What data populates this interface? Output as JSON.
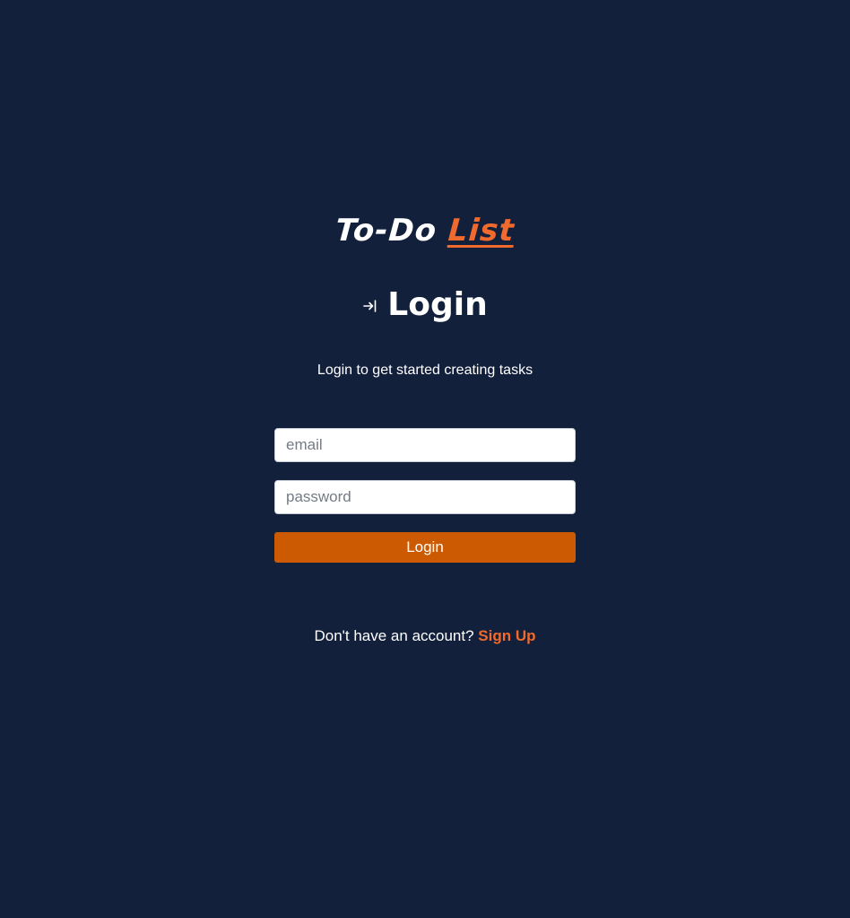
{
  "logo": {
    "first_word": "To-Do",
    "accent_word": "List",
    "accent_color": "#ef6a2c"
  },
  "heading": {
    "icon": "login-arrow-icon",
    "title": "Login"
  },
  "subtitle": "Login to get started creating tasks",
  "form": {
    "email": {
      "placeholder": "email",
      "value": ""
    },
    "password": {
      "placeholder": "password",
      "value": ""
    },
    "submit_label": "Login",
    "submit_color": "#cc5a03"
  },
  "signup": {
    "prompt": "Don't have an account?",
    "link_label": "Sign Up"
  },
  "colors": {
    "background": "#13203c",
    "text": "#ffffff"
  }
}
